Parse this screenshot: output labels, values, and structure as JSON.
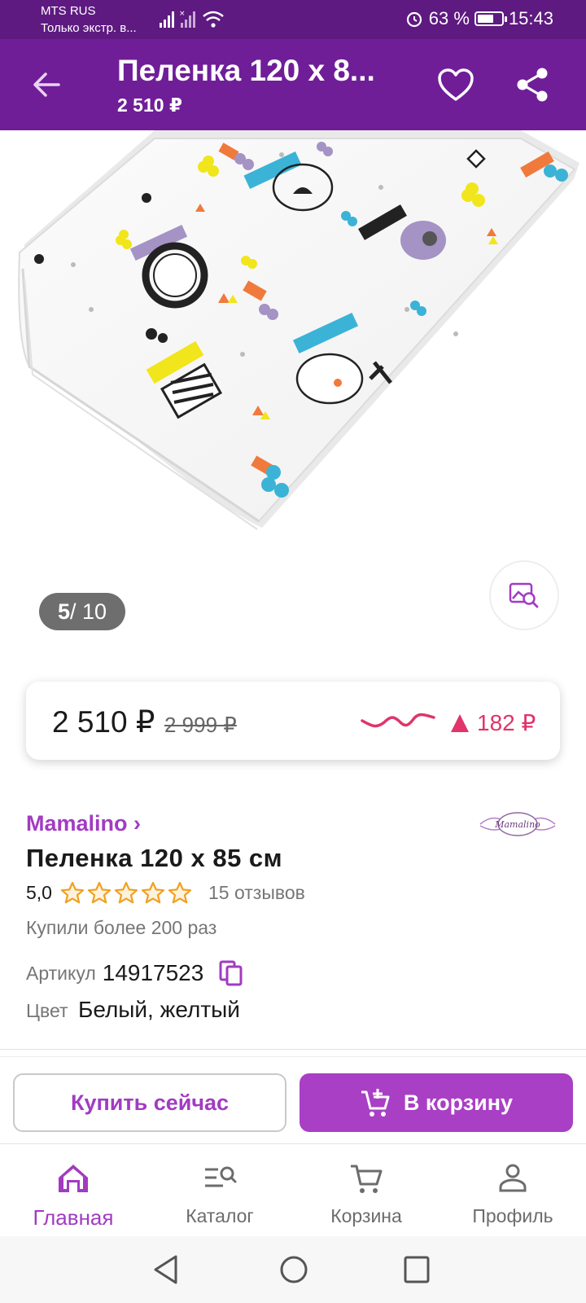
{
  "status_bar": {
    "operator": "MTS RUS",
    "operator_sub": "Только экстр. в...",
    "battery": "63 %",
    "battery_level": 0.63,
    "time": "15:43"
  },
  "app_bar": {
    "title": "Пеленка 120 x 8...",
    "subtitle": "2 510 ₽",
    "back_icon": "arrow-left-icon",
    "favorite_icon": "heart-icon",
    "share_icon": "share-icon"
  },
  "gallery": {
    "counter_current": "5",
    "counter_rest": " / 10",
    "photo_search_icon": "image-search-icon"
  },
  "price_card": {
    "price": "2 510 ₽",
    "old_price": "2 999 ₽",
    "price_change": "182 ₽",
    "accent_color": "#e0346a"
  },
  "product": {
    "brand": "Mamalino ›",
    "brand_logo_text": "Mamalino",
    "name": "Пеленка 120 x 85 см",
    "rating": "5,0",
    "stars": 5,
    "reviews": "15 отзывов",
    "bought": "Купили более 200 раз",
    "article_label": "Артикул",
    "article_value": "14917523",
    "color_label": "Цвет",
    "color_value": "Белый, желтый"
  },
  "actions": {
    "buy_now": "Купить сейчас",
    "add_to_cart": "В корзину",
    "brand_color": "#a93fc5"
  },
  "bottom_nav": {
    "items": [
      {
        "label": "Главная",
        "icon": "home-icon",
        "active": true
      },
      {
        "label": "Каталог",
        "icon": "catalog-search-icon",
        "active": false
      },
      {
        "label": "Корзина",
        "icon": "cart-icon",
        "active": false
      },
      {
        "label": "Профиль",
        "icon": "profile-icon",
        "active": false
      }
    ]
  }
}
